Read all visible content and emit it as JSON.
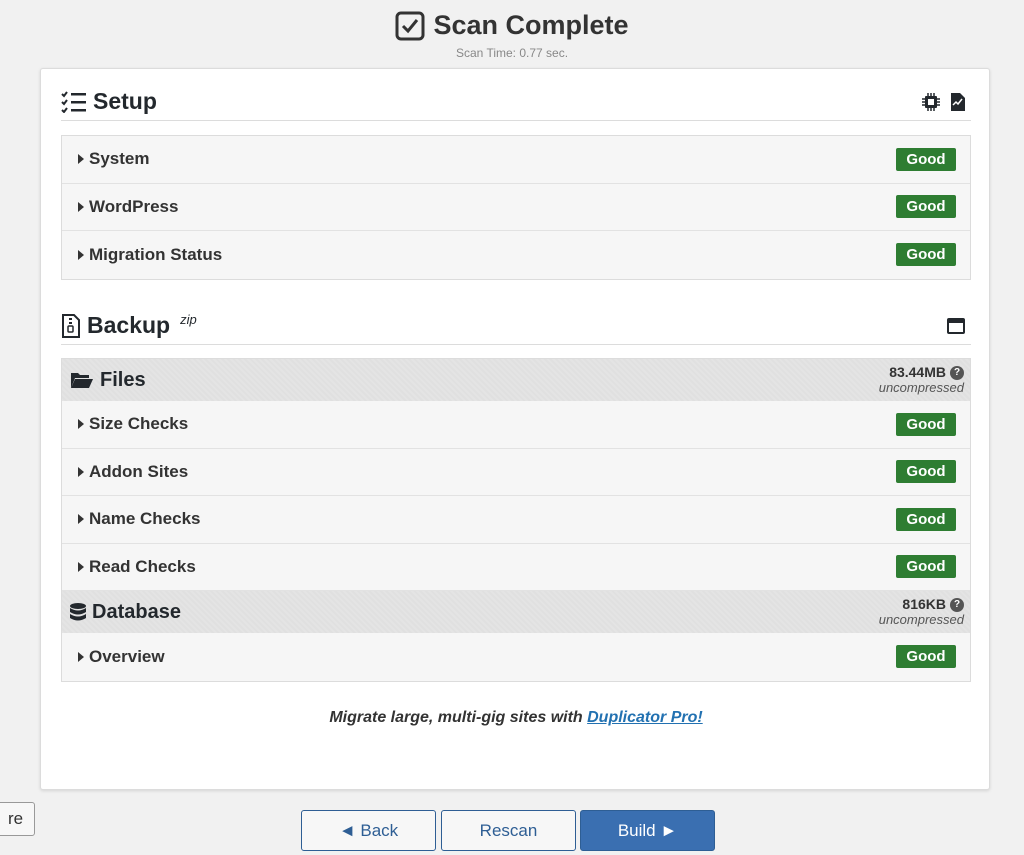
{
  "header": {
    "title": "Scan Complete",
    "scan_time": "Scan Time: 0.77 sec."
  },
  "setup": {
    "title": "Setup",
    "items": [
      {
        "label": "System",
        "status": "Good"
      },
      {
        "label": "WordPress",
        "status": "Good"
      },
      {
        "label": "Migration Status",
        "status": "Good"
      }
    ]
  },
  "backup": {
    "title": "Backup",
    "format": "zip",
    "files": {
      "label": "Files",
      "size": "83.44MB",
      "size_note": "uncompressed",
      "items": [
        {
          "label": "Size Checks",
          "status": "Good"
        },
        {
          "label": "Addon Sites",
          "status": "Good"
        },
        {
          "label": "Name Checks",
          "status": "Good"
        },
        {
          "label": "Read Checks",
          "status": "Good"
        }
      ]
    },
    "database": {
      "label": "Database",
      "size": "816KB",
      "size_note": "uncompressed",
      "items": [
        {
          "label": "Overview",
          "status": "Good"
        }
      ]
    }
  },
  "promo": {
    "text": "Migrate large, multi-gig sites with ",
    "link": "Duplicator Pro!"
  },
  "buttons": {
    "back": "◄ Back",
    "rescan": "Rescan",
    "build": "Build ►",
    "side": "re"
  },
  "colors": {
    "good": "#2e7d32",
    "primary": "#3a6fb1",
    "link": "#2271b1"
  }
}
